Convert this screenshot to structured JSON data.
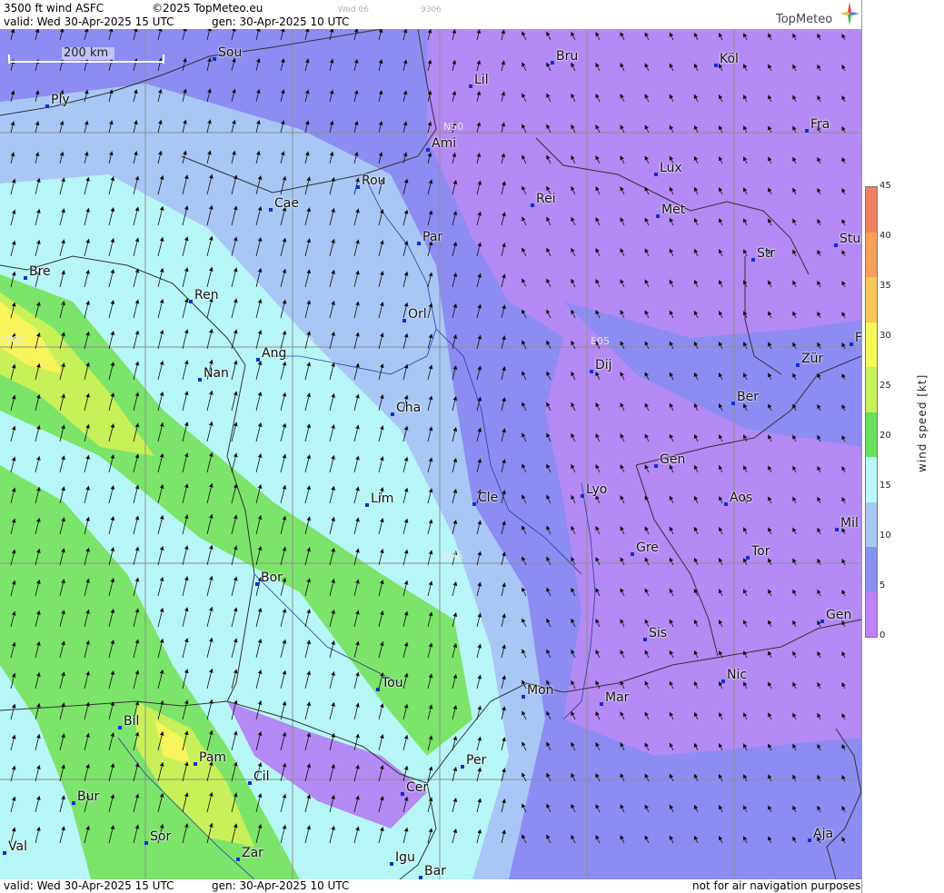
{
  "header": {
    "product": "3500 ft wind ASFC",
    "copyright": "©2025 TopMeteo.eu",
    "valid": "valid:  Wed  30-Apr-2025  15 UTC",
    "gen": "gen: 30-Apr-2025 10 UTC",
    "faint_day": "Wed 06",
    "faint_code": "9306",
    "logo": "TopMeteo"
  },
  "footer": {
    "valid": "valid:  Wed  30-Apr-2025  15 UTC",
    "gen": "gen: 30-Apr-2025 10 UTC",
    "disclaimer": "not for air navigation purposes"
  },
  "map": {
    "scale_label": "200 km",
    "grid_labels": [
      "N50",
      "N45",
      "W05",
      "E00",
      "E05"
    ],
    "cities": [
      "Sou",
      "Bru",
      "Köl",
      "Ply",
      "Lil",
      "Ami",
      "Fra",
      "Rou",
      "Lux",
      "Cae",
      "Rei",
      "Met",
      "Par",
      "Str",
      "Stu",
      "Bre",
      "Ren",
      "Orl",
      "Ang",
      "Nan",
      "Dij",
      "Zür",
      "F",
      "Cha",
      "Ber",
      "Gen",
      "Lim",
      "Cle",
      "Lyo",
      "Aos",
      "Mil",
      "Gre",
      "Bor",
      "Tor",
      "Sis",
      "Gen",
      "Tou",
      "Mon",
      "Mar",
      "Nic",
      "Bil",
      "Pam",
      "Cil",
      "Per",
      "Cer",
      "Bur",
      "Sor",
      "Zar",
      "Aja",
      "Igu",
      "Bar",
      "Val"
    ]
  },
  "legend": {
    "unit": "wind  speed  [kt]",
    "ticks": [
      "45",
      "40",
      "35",
      "30",
      "25",
      "20",
      "15",
      "10",
      "5",
      "0"
    ],
    "colors": [
      "#f08060",
      "#f8a058",
      "#f8c858",
      "#f8f858",
      "#c8f058",
      "#68e058",
      "#b8f8f8",
      "#a8c8f8",
      "#8890f0",
      "#c080f8"
    ]
  }
}
